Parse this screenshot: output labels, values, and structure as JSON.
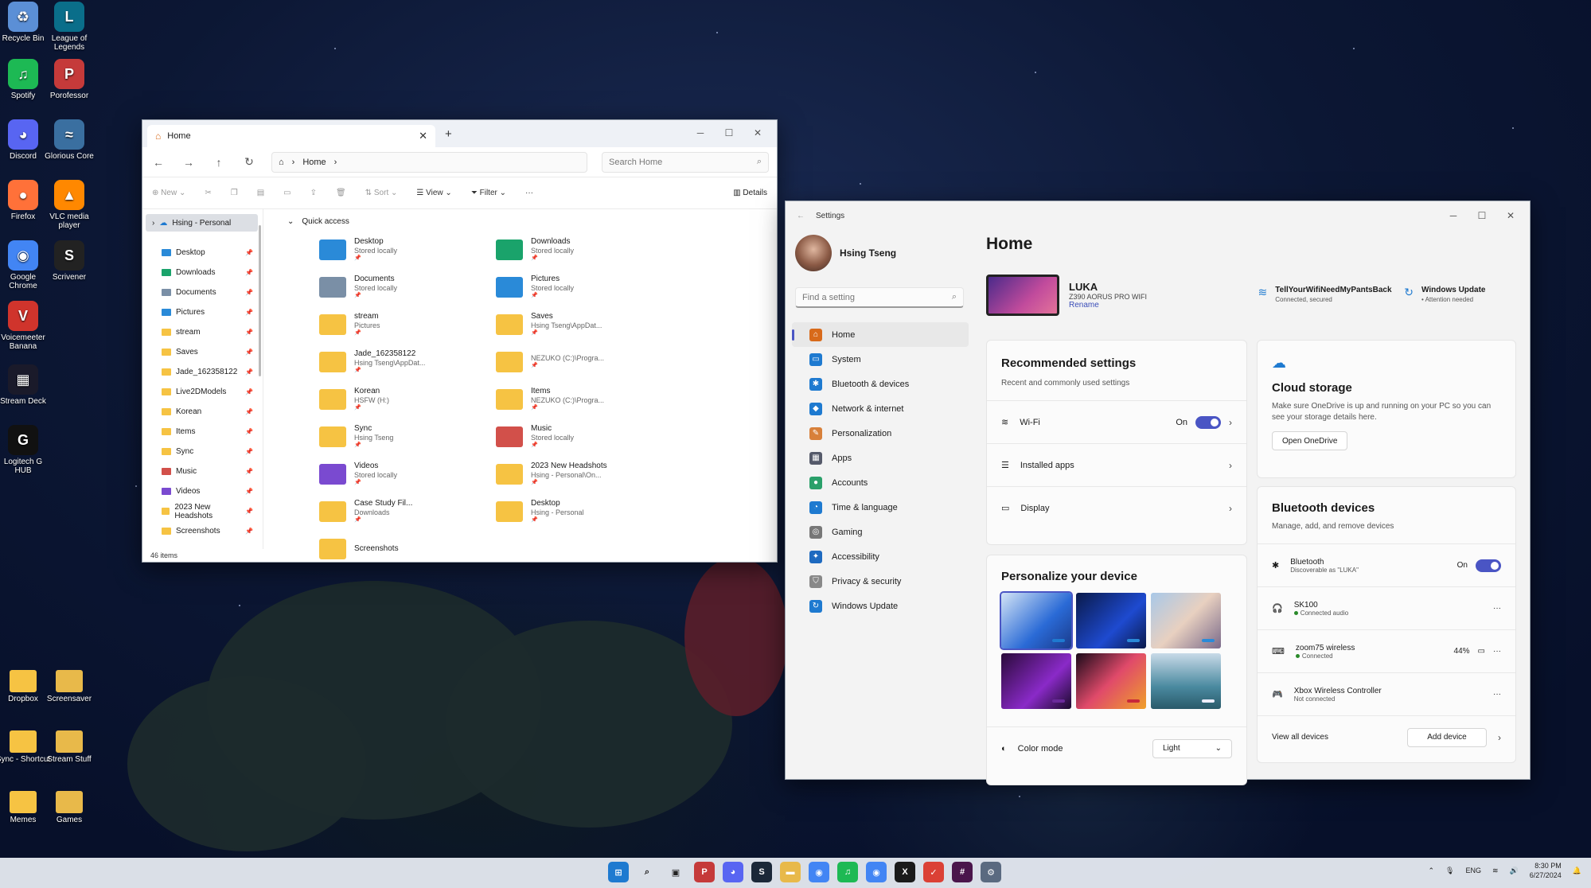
{
  "desktop": {
    "icons_left": [
      {
        "label": "Recycle Bin",
        "glyph": "♻",
        "color": "#5b8fd6"
      },
      {
        "label": "Spotify",
        "glyph": "♫",
        "color": "#1db954"
      },
      {
        "label": "Discord",
        "glyph": "◕",
        "color": "#5865f2"
      },
      {
        "label": "Firefox",
        "glyph": "●",
        "color": "#ff7139"
      },
      {
        "label": "Google Chrome",
        "glyph": "◉",
        "color": "#4285f4"
      },
      {
        "label": "Voicemeeter Banana",
        "glyph": "V",
        "color": "#d0342c"
      },
      {
        "label": "Stream Deck",
        "glyph": "▦",
        "color": "#1a1a2a"
      },
      {
        "label": "Logitech G HUB",
        "glyph": "G",
        "color": "#111111"
      }
    ],
    "icons_right": [
      {
        "label": "League of Legends",
        "glyph": "L",
        "color": "#0a6e8a"
      },
      {
        "label": "Porofessor",
        "glyph": "P",
        "color": "#c53a3a"
      },
      {
        "label": "Glorious Core",
        "glyph": "≈",
        "color": "#3a6fa0"
      },
      {
        "label": "VLC media player",
        "glyph": "▲",
        "color": "#ff8800"
      },
      {
        "label": "Scrivener",
        "glyph": "S",
        "color": "#222222"
      }
    ],
    "icons_bottom": [
      {
        "label": "Dropbox",
        "color": "#f6c343"
      },
      {
        "label": "Screensaver",
        "color": "#e8b94a"
      },
      {
        "label": "Sync - Shortcut",
        "color": "#f6c343"
      },
      {
        "label": "Stream Stuff",
        "color": "#e8b94a"
      },
      {
        "label": "Memes",
        "color": "#f6c343"
      },
      {
        "label": "Games",
        "color": "#e8b94a"
      }
    ]
  },
  "explorer": {
    "tab_title": "Home",
    "breadcrumb": "Home",
    "search_placeholder": "Search Home",
    "toolbar": {
      "new": "New",
      "sort": "Sort",
      "view": "View",
      "filter": "Filter",
      "more": "···",
      "details": "Details"
    },
    "nav_onedrive": "Hsing - Personal",
    "nav_items": [
      {
        "label": "Desktop",
        "color": "#2a8ad8"
      },
      {
        "label": "Downloads",
        "color": "#1aa36b"
      },
      {
        "label": "Documents",
        "color": "#7a8fa6"
      },
      {
        "label": "Pictures",
        "color": "#2a8ad8"
      },
      {
        "label": "stream",
        "color": "#f6c343"
      },
      {
        "label": "Saves",
        "color": "#f6c343"
      },
      {
        "label": "Jade_162358122",
        "color": "#f6c343"
      },
      {
        "label": "Live2DModels",
        "color": "#f6c343"
      },
      {
        "label": "Korean",
        "color": "#f6c343"
      },
      {
        "label": "Items",
        "color": "#f6c343"
      },
      {
        "label": "Sync",
        "color": "#f6c343"
      },
      {
        "label": "Music",
        "color": "#d2504a"
      },
      {
        "label": "Videos",
        "color": "#7a4ad0"
      },
      {
        "label": "2023 New Headshots",
        "color": "#f6c343"
      },
      {
        "label": "Screenshots",
        "color": "#f6c343"
      }
    ],
    "quick_access_label": "Quick access",
    "quick_access": [
      {
        "name": "Desktop",
        "sub": "Stored locally",
        "color": "#2a8ad8"
      },
      {
        "name": "Downloads",
        "sub": "Stored locally",
        "color": "#1aa36b"
      },
      {
        "name": "Documents",
        "sub": "Stored locally",
        "color": "#7a8fa6"
      },
      {
        "name": "Pictures",
        "sub": "Stored locally",
        "color": "#2a8ad8"
      },
      {
        "name": "stream",
        "sub": "Pictures",
        "color": "#f6c343"
      },
      {
        "name": "Saves",
        "sub": "Hsing Tseng\\AppDat...",
        "color": "#f6c343"
      },
      {
        "name": "Jade_162358122",
        "sub": "Hsing Tseng\\AppDat...",
        "color": "#f6c343"
      },
      {
        "name": "",
        "sub": "NEZUKO (C:)\\Progra...",
        "color": "#f6c343"
      },
      {
        "name": "Korean",
        "sub": "HSFW (H:)",
        "color": "#f6c343"
      },
      {
        "name": "Items",
        "sub": "NEZUKO (C:)\\Progra...",
        "color": "#f6c343"
      },
      {
        "name": "Sync",
        "sub": "Hsing Tseng",
        "color": "#f6c343"
      },
      {
        "name": "Music",
        "sub": "Stored locally",
        "color": "#d2504a"
      },
      {
        "name": "Videos",
        "sub": "Stored locally",
        "color": "#7a4ad0"
      },
      {
        "name": "2023 New Headshots",
        "sub": "Hsing - Personal\\On...",
        "color": "#f6c343"
      },
      {
        "name": "Case Study Fil...",
        "sub": "Downloads",
        "color": "#f6c343"
      },
      {
        "name": "Desktop",
        "sub": "Hsing - Personal",
        "color": "#f6c343"
      },
      {
        "name": "Screenshots",
        "sub": "",
        "color": "#f6c343"
      }
    ],
    "status": "46 items"
  },
  "settings": {
    "title": "Settings",
    "user_name": "Hsing Tseng",
    "search_placeholder": "Find a setting",
    "nav": [
      {
        "label": "Home",
        "color": "#d86a1a",
        "glyph": "⌂"
      },
      {
        "label": "System",
        "color": "#1e7ad0",
        "glyph": "▭"
      },
      {
        "label": "Bluetooth & devices",
        "color": "#1e7ad0",
        "glyph": "✱"
      },
      {
        "label": "Network & internet",
        "color": "#1e7ad0",
        "glyph": "◆"
      },
      {
        "label": "Personalization",
        "color": "#d8803a",
        "glyph": "✎"
      },
      {
        "label": "Apps",
        "color": "#555a6a",
        "glyph": "▦"
      },
      {
        "label": "Accounts",
        "color": "#2aa06a",
        "glyph": "●"
      },
      {
        "label": "Time & language",
        "color": "#1e7ad0",
        "glyph": "◔"
      },
      {
        "label": "Gaming",
        "color": "#777777",
        "glyph": "◎"
      },
      {
        "label": "Accessibility",
        "color": "#1e6ac0",
        "glyph": "✦"
      },
      {
        "label": "Privacy & security",
        "color": "#888888",
        "glyph": "⛉"
      },
      {
        "label": "Windows Update",
        "color": "#1e7ad0",
        "glyph": "↻"
      }
    ],
    "heading": "Home",
    "device": {
      "name": "LUKA",
      "model": "Z390 AORUS PRO WIFI",
      "rename": "Rename"
    },
    "wifi_status": {
      "name": "TellYourWifiNeedMyPantsBack",
      "sub": "Connected, secured"
    },
    "update_status": {
      "name": "Windows Update",
      "sub": "Attention needed"
    },
    "recommended": {
      "title": "Recommended settings",
      "desc": "Recent and commonly used settings",
      "rows": [
        {
          "label": "Wi-Fi",
          "state": "On"
        },
        {
          "label": "Installed apps",
          "state": ""
        },
        {
          "label": "Display",
          "state": ""
        }
      ]
    },
    "personalize": {
      "title": "Personalize your device",
      "color_mode_label": "Color mode",
      "color_mode_value": "Light"
    },
    "cloud": {
      "title": "Cloud storage",
      "desc": "Make sure OneDrive is up and running on your PC so you can see your storage details here.",
      "button": "Open OneDrive"
    },
    "bluetooth": {
      "title": "Bluetooth devices",
      "desc": "Manage, add, and remove devices",
      "main": {
        "label": "Bluetooth",
        "sub": "Discoverable as \"LUKA\"",
        "state": "On"
      },
      "devices": [
        {
          "name": "SK100",
          "status": "Connected audio",
          "battery": "",
          "connected": true,
          "icon": "headset-icon"
        },
        {
          "name": "zoom75 wireless",
          "status": "Connected",
          "battery": "44%",
          "connected": true,
          "icon": "keyboard-icon"
        },
        {
          "name": "Xbox Wireless Controller",
          "status": "Not connected",
          "battery": "",
          "connected": false,
          "icon": "gamepad-icon"
        }
      ],
      "view_all": "View all devices",
      "add_device": "Add device"
    }
  },
  "taskbar": {
    "apps": [
      {
        "name": "start",
        "color": "#1e7ad0",
        "glyph": "⊞"
      },
      {
        "name": "search",
        "color": "#333333",
        "glyph": "⌕"
      },
      {
        "name": "task-view",
        "color": "#333333",
        "glyph": "▣"
      },
      {
        "name": "porofessor",
        "color": "#c53a3a",
        "glyph": "P"
      },
      {
        "name": "discord",
        "color": "#5865f2",
        "glyph": "◕"
      },
      {
        "name": "steam",
        "color": "#1b2838",
        "glyph": "S"
      },
      {
        "name": "file-explorer",
        "color": "#e8b94a",
        "glyph": "▬"
      },
      {
        "name": "chrome",
        "color": "#4285f4",
        "glyph": "◉"
      },
      {
        "name": "spotify",
        "color": "#1db954",
        "glyph": "♫"
      },
      {
        "name": "chrome-2",
        "color": "#4285f4",
        "glyph": "◉"
      },
      {
        "name": "xbox",
        "color": "#1a1a1a",
        "glyph": "X"
      },
      {
        "name": "todoist",
        "color": "#db4035",
        "glyph": "✓"
      },
      {
        "name": "slack",
        "color": "#4a154b",
        "glyph": "#"
      },
      {
        "name": "settings",
        "color": "#5a6a80",
        "glyph": "⚙"
      }
    ],
    "lang": "ENG",
    "time": "8:30 PM",
    "date": "6/27/2024"
  }
}
